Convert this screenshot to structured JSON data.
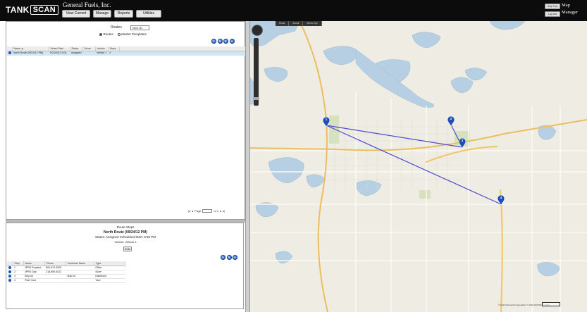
{
  "header": {
    "logo_left": "TANK",
    "logo_right": "SCAN",
    "company": "General Fuels, Inc.",
    "nav": [
      "View Current",
      "Manage",
      "Reports",
      "Utilities"
    ],
    "small_buttons": [
      "Help Tips",
      "Log Out"
    ],
    "right_labels": [
      "Map",
      "Manager"
    ]
  },
  "routes": {
    "title": "Routes",
    "filter_value": "Next 30",
    "radio_options": [
      "Routes",
      "Master Templates"
    ],
    "columns": [
      "Name ▲",
      "Sched Start",
      "Status",
      "Driver",
      "Vehicle",
      "Stops"
    ],
    "rows": [
      [
        "North Route (09/24/12 PM)",
        "9/24/2012 9:00",
        "Assigned",
        "",
        "Vehicle 1",
        "4"
      ]
    ],
    "pager": {
      "page_label": "Page",
      "of_label": "of 1"
    }
  },
  "route_stops": {
    "title": "Route Stops",
    "route_name": "North Route (09/24/12 PM)",
    "status_line": "Status: Assigned   Scheduled Start: 9:30 PM",
    "vehicle_line": "Vehicle: Vehicle 1",
    "edit_label": "Edit",
    "columns": [
      "Stop",
      "Name",
      "Phone",
      "Customer Name",
      "Type"
    ],
    "rows": [
      [
        "1",
        "JPRD Propane",
        "800-879-3925",
        "",
        "Office"
      ],
      [
        "2",
        "JPRD Gas",
        "218-659-4022",
        "",
        "Store"
      ],
      [
        "3",
        "Ship #3",
        "",
        "Ship #3",
        "Distributor"
      ],
      [
        "4",
        "Fleet Yard",
        "",
        "",
        "Yard"
      ]
    ]
  },
  "map": {
    "tabs": [
      "Road",
      "Aerial",
      "Bird's Eye"
    ],
    "pins": [
      "1",
      "2",
      "3",
      "4"
    ],
    "copyright": "© 2012 Microsoft Corporation   © 2010 NAVTEQ © AND",
    "route_color": "#4c4ccf",
    "pin_color": "#1f4fb5"
  }
}
